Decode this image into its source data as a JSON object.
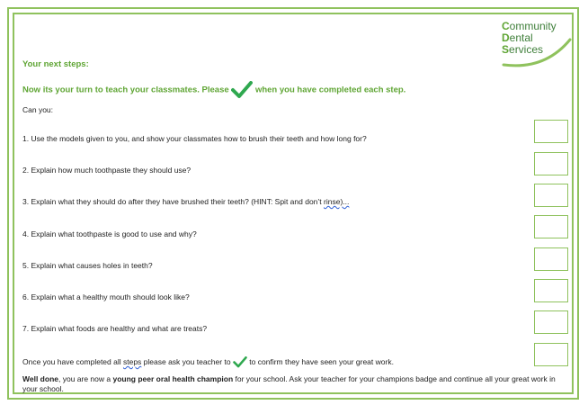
{
  "logo": {
    "line1_cap": "C",
    "line1_rest": "ommunity",
    "line2_cap": "D",
    "line2_rest": "ental",
    "line3_cap": "S",
    "line3_rest": "ervices"
  },
  "heading": "Your next steps:",
  "instruction_before": "Now its your turn to teach your classmates. Please",
  "instruction_after": "when you have completed each step.",
  "can_you": "Can you:",
  "steps": [
    "1. Use the models given to you, and show your classmates how to brush their teeth and how long for?",
    "2. Explain how much toothpaste they should use?",
    "3. Explain what they should do after they have brushed their teeth? (HINT: Spit and don’t ",
    "4. Explain what toothpaste is good to use and why?",
    "5. Explain what causes holes in teeth?",
    "6. Explain what a healthy mouth should look like?",
    "7. Explain what foods are healthy and what are treats?"
  ],
  "step3_tail": "rinse)",
  "confirm_before": "Once you have completed all ",
  "confirm_steps_word": "steps",
  "confirm_middle": " please ask you teacher to",
  "confirm_after": "to confirm they have seen your great work.",
  "final_bold1": "Well done",
  "final_text1": ", you are now a ",
  "final_bold2": "young peer oral health champion",
  "final_text2": " for your school. Ask your teacher for your champions badge and continue all your great work in your school.",
  "colors": {
    "green": "#5fa534",
    "border": "#8fc25d",
    "logo_dark": "#3f7f3a",
    "check": "#2fa84f"
  }
}
